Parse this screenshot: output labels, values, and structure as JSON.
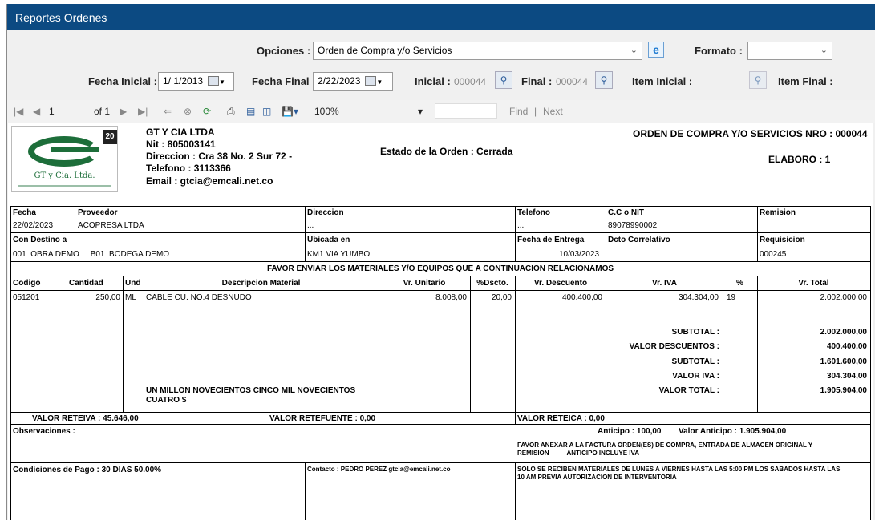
{
  "window": {
    "title": "Reportes Ordenes"
  },
  "options": {
    "opciones_label": "Opciones :",
    "opciones_value": "Orden de Compra y/o Servicios",
    "formato_label": "Formato :",
    "formato_value": "",
    "fecha_inicial_label": "Fecha Inicial :",
    "fecha_inicial_value": "1/ 1/2013",
    "fecha_final_label": "Fecha Final :",
    "fecha_final_value": "2/22/2023",
    "inicial_label": "Inicial :",
    "inicial_value": "000044",
    "final_label": "Final :",
    "final_value": "000044",
    "item_inicial_label": "Item Inicial :",
    "item_final_label": "Item Final :"
  },
  "toolbar": {
    "page": "1",
    "of_pages": "of 1",
    "zoom": "100%",
    "find": "Find",
    "next": "Next"
  },
  "report": {
    "company": {
      "name": "GT Y CIA LTDA",
      "nit": "Nit :  805003141",
      "direccion": "Direccion :  Cra 38 No. 2 Sur 72 -",
      "telefono": "Telefono :  3113366",
      "email": "Email :  gtcia@emcali.net.co",
      "logo_text": "GT y Cia. Ltda.",
      "logo_badge": "20"
    },
    "estado": "Estado de la Orden :  Cerrada",
    "orden_nro": "ORDEN DE COMPRA Y/O SERVICIOS NRO :  000044",
    "elaboro": "ELABORO : 1",
    "header_fields": {
      "fecha_label": "Fecha",
      "fecha": "22/02/2023",
      "proveedor_label": "Proveedor",
      "proveedor": "ACOPRESA LTDA",
      "direccion_label": "Direccion",
      "direccion": "...",
      "telefono_label": "Telefono",
      "telefono": "...",
      "cc_nit_label": "C.C o NIT",
      "cc_nit": "89078990002",
      "remision_label": "Remision",
      "remision": "",
      "destino_label": "Con Destino a",
      "destino": "001  OBRA DEMO     B01  BODEGA DEMO",
      "ubicada_label": "Ubicada en",
      "ubicada": "KM1 VIA YUMBO",
      "fecha_entrega_label": "Fecha de Entrega",
      "fecha_entrega": "10/03/2023",
      "dcto_label": "Dcto Correlativo",
      "dcto": "",
      "requisicion_label": "Requisicion",
      "requisicion": "000245"
    },
    "favor_text": "FAVOR ENVIAR LOS MATERIALES Y/O EQUIPOS QUE A CONTINUACION RELACIONAMOS",
    "columns": [
      "Codigo",
      "Cantidad",
      "Und",
      "Descripcion Material",
      "Vr. Unitario",
      "%Dscto.",
      "Vr. Descuento",
      "Vr. IVA",
      "%",
      "Vr. Total"
    ],
    "item": {
      "codigo": "051201",
      "cantidad": "250,00",
      "und": "ML",
      "descripcion": "CABLE CU. NO.4 DESNUDO",
      "vr_unitario": "8.008,00",
      "dscto": "20,00",
      "vr_descuento": "400.400,00",
      "vr_iva": "304.304,00",
      "pct": "19",
      "vr_total": "2.002.000,00"
    },
    "son_line1": "UN MILLON NOVECIENTOS CINCO MIL NOVECIENTOS",
    "son_line2": "CUATRO $",
    "totals": {
      "subtotal1_label": "SUBTOTAL :",
      "subtotal1": "2.002.000,00",
      "descuentos_label": "VALOR DESCUENTOS :",
      "descuentos": "400.400,00",
      "subtotal2_label": "SUBTOTAL :",
      "subtotal2": "1.601.600,00",
      "iva_label": "VALOR IVA :",
      "iva": "304.304,00",
      "total_label": "VALOR TOTAL :",
      "total": "1.905.904,00"
    },
    "retenciones": {
      "reteiva": "VALOR RETEIVA : 45.646,00",
      "retefuente": "VALOR RETEFUENTE : 0,00",
      "reteica": "VALOR RETEICA : 0,00"
    },
    "observaciones_label": "Observaciones :",
    "anticipo": "Anticipo : 100,00",
    "valor_anticipo": "Valor Anticipo : 1.905.904,00",
    "nota_line1": "FAVOR ANEXAR A LA FACTURA ORDEN(ES) DE COMPRA, ENTRADA DE ALMACEN ORIGINAL Y",
    "nota_line2": "REMISION          ANTICIPO INCLUYE IVA",
    "condiciones": "Condiciones de Pago : 30 DIAS 50.00%",
    "contacto": "Contacto : PEDRO PEREZ gtcia@emcali.net.co",
    "solo_line1": "SOLO SE RECIBEN MATERIALES DE LUNES A VIERNES HASTA LAS 5:00 PM LOS SABADOS HASTA LAS",
    "solo_line2": "10 AM PREVIA AUTORIZACION DE INTERVENTORIA"
  },
  "colors": {
    "titlebar": "#0c4a82",
    "logo_green": "#1d6e3a"
  }
}
